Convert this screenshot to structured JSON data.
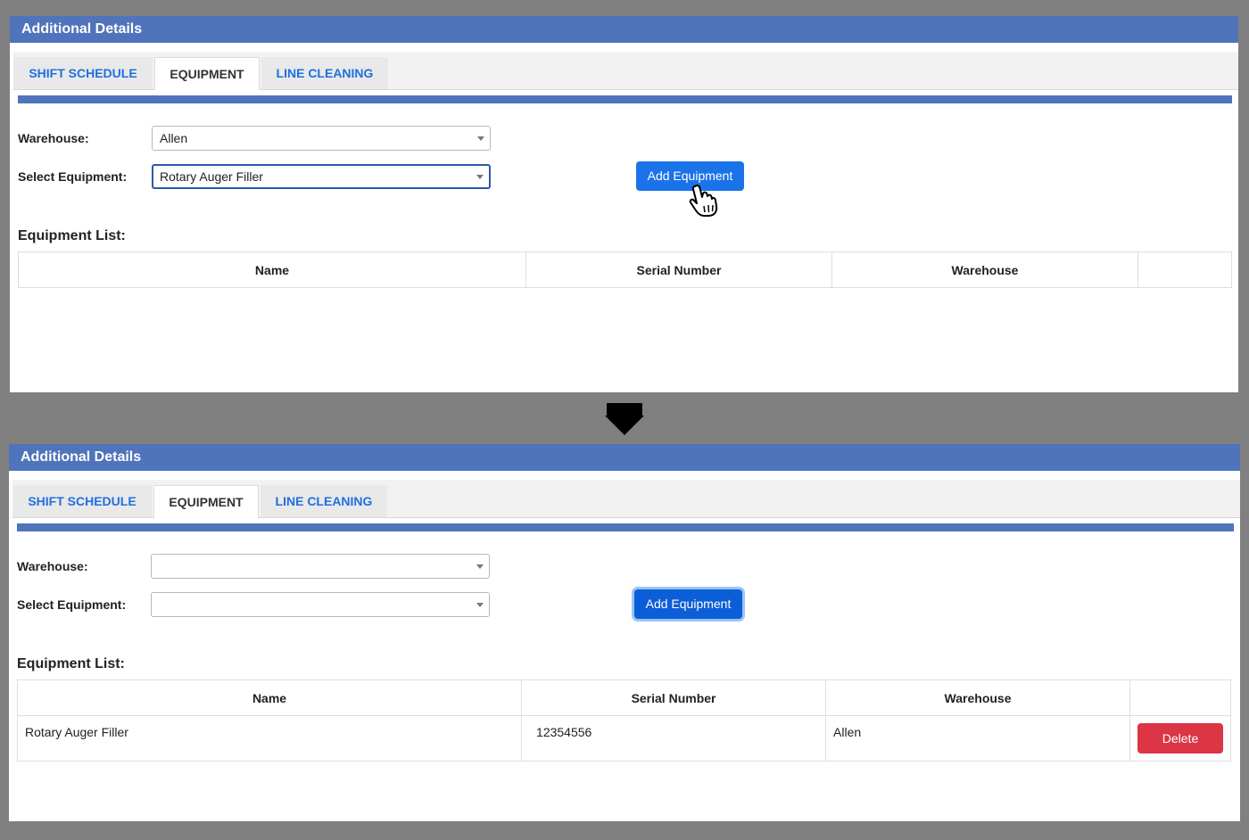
{
  "before": {
    "header": {
      "title": "Additional Details"
    },
    "tabs": [
      {
        "label": "SHIFT SCHEDULE"
      },
      {
        "label": "EQUIPMENT",
        "active": true
      },
      {
        "label": "LINE CLEANING"
      }
    ],
    "form": {
      "warehouse_label": "Warehouse:",
      "warehouse_value": "Allen",
      "equipment_label": "Select Equipment:",
      "equipment_value": "Rotary Auger Filler",
      "add_button": "Add Equipment"
    },
    "list": {
      "title": "Equipment List:",
      "columns": [
        "Name",
        "Serial Number",
        "Warehouse",
        ""
      ],
      "rows": []
    }
  },
  "after": {
    "header": {
      "title": "Additional Details"
    },
    "tabs": [
      {
        "label": "SHIFT SCHEDULE"
      },
      {
        "label": "EQUIPMENT",
        "active": true
      },
      {
        "label": "LINE CLEANING"
      }
    ],
    "form": {
      "warehouse_label": "Warehouse:",
      "warehouse_value": "",
      "equipment_label": "Select Equipment:",
      "equipment_value": "",
      "add_button": "Add Equipment"
    },
    "list": {
      "title": "Equipment List:",
      "columns": [
        "Name",
        "Serial Number",
        "Warehouse",
        ""
      ],
      "rows": [
        {
          "name": "Rotary Auger Filler",
          "serial": "12354556",
          "warehouse": "Allen",
          "action": "Delete"
        }
      ]
    }
  },
  "icons": {
    "transition": "down-arrow-icon",
    "cursor": "pointer-hand-icon"
  },
  "colors": {
    "header": "#4f74bb",
    "primary": "#1a73e8",
    "danger": "#dc3545",
    "tab_link": "#1f6fe0"
  }
}
